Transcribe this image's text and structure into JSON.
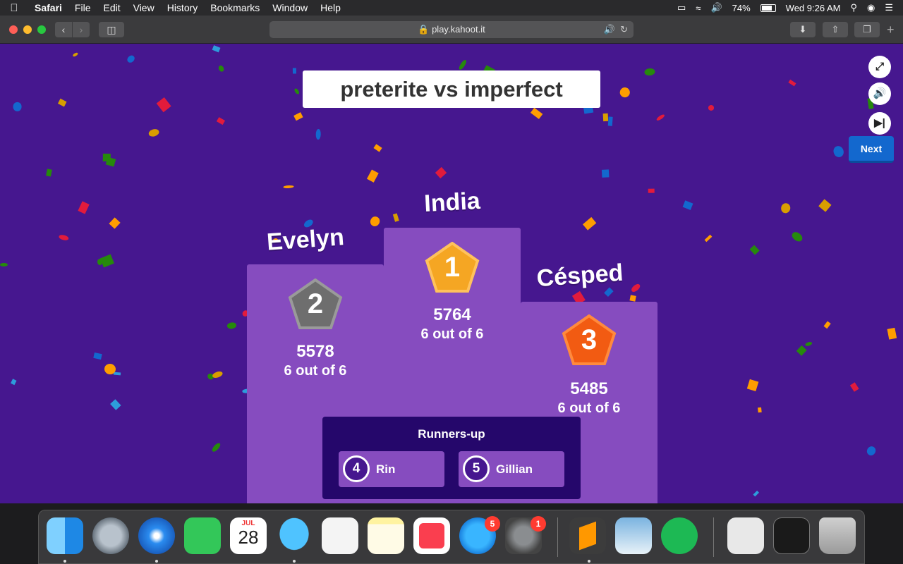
{
  "menubar": {
    "app": "Safari",
    "items": [
      "File",
      "Edit",
      "View",
      "History",
      "Bookmarks",
      "Window",
      "Help"
    ],
    "battery": "74%",
    "clock": "Wed 9:26 AM"
  },
  "browser": {
    "url": "play.kahoot.it"
  },
  "game": {
    "quiz_title": "preterite vs imperfect",
    "next_label": "Next",
    "podium": [
      {
        "rank": "1",
        "name": "India",
        "score": "5764",
        "correct": "6 out of 6",
        "medal_color": "#f5a623"
      },
      {
        "rank": "2",
        "name": "Evelyn",
        "score": "5578",
        "correct": "6 out of 6",
        "medal_color": "#6e6e6e"
      },
      {
        "rank": "3",
        "name": "Césped",
        "score": "5485",
        "correct": "6 out of 6",
        "medal_color": "#f25b12"
      }
    ],
    "runners_up_title": "Runners-up",
    "runners_up": [
      {
        "rank": "4",
        "name": "Rin"
      },
      {
        "rank": "5",
        "name": "Gillian"
      }
    ]
  },
  "dock": {
    "apps": [
      "Finder",
      "Launchpad",
      "Safari",
      "FaceTime",
      "Calendar",
      "Messages",
      "Reminders",
      "Notes",
      "News",
      "App Store",
      "System Preferences",
      "Sublime Text",
      "Preview",
      "Spotify",
      "Documents",
      "Terminal",
      "Trash"
    ],
    "calendar_month": "JUL",
    "calendar_day": "28",
    "app_store_badge": "5",
    "system_prefs_badge": "1"
  }
}
